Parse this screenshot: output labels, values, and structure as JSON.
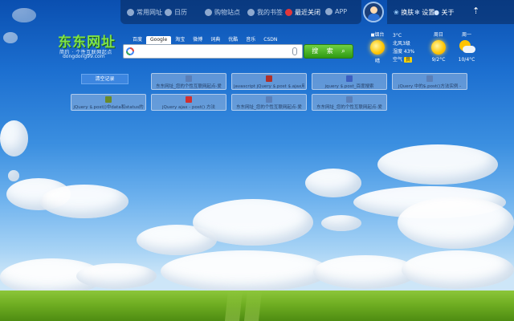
{
  "topbar": {
    "items": [
      {
        "label": "常用网址",
        "icon": "globe-icon"
      },
      {
        "label": "日历"
      },
      {
        "label": "购物站点"
      },
      {
        "label": "我的书签"
      },
      {
        "label": "最近关闭",
        "icon": "close-icon",
        "active": true
      },
      {
        "label": "APP"
      }
    ],
    "right": {
      "skin_label": "换肤",
      "settings_label": "设置",
      "about_label": "关于",
      "arrow": "⇡"
    }
  },
  "logo": {
    "title": "东东网址",
    "subtitle": "简约 · 个性互联网起点",
    "url": "dongdong99.com"
  },
  "search": {
    "tabs": [
      "百度",
      "Google",
      "淘宝",
      "微博",
      "词典",
      "优酷",
      "音乐",
      "CSDN"
    ],
    "active_tab": "Google",
    "value": "",
    "button_label": "搜 索"
  },
  "weather": {
    "location": "烟台",
    "today_icon": "sun-icon",
    "today_label": "晴",
    "temp": "3°C",
    "wind": "北风3级",
    "humidity": "湿度 43%",
    "air_label": "空气",
    "air_value": "良",
    "forecast": [
      {
        "day": "周日",
        "icon": "sun-icon",
        "range": "9/2°C"
      },
      {
        "day": "周一",
        "icon": "partly-cloudy-icon",
        "range": "10/4°C"
      }
    ]
  },
  "history": {
    "clear_label": "清空记录",
    "cards": [
      {
        "title": "东东网址_您的个性互联网起点-爱",
        "color": "#5a7fb8"
      },
      {
        "title": "javascript jQuery $.post $.ajax用",
        "color": "#b0302a"
      },
      {
        "title": "jquery $.post_百度搜索",
        "color": "#3c5fc0"
      },
      {
        "title": "jQuery 中的$.post()方法实例 -",
        "color": "#5a7fb8"
      },
      {
        "title": "jQuery $.post()中data和status的",
        "color": "#6a8a2a"
      },
      {
        "title": "jQuery ajax - post() 方法",
        "color": "#d03030"
      },
      {
        "title": "东东网址_您的个性互联网起点-爱",
        "color": "#5a7fb8"
      },
      {
        "title": "东东网址_您的个性互联网起点-爱",
        "color": "#5a7fb8"
      }
    ]
  }
}
